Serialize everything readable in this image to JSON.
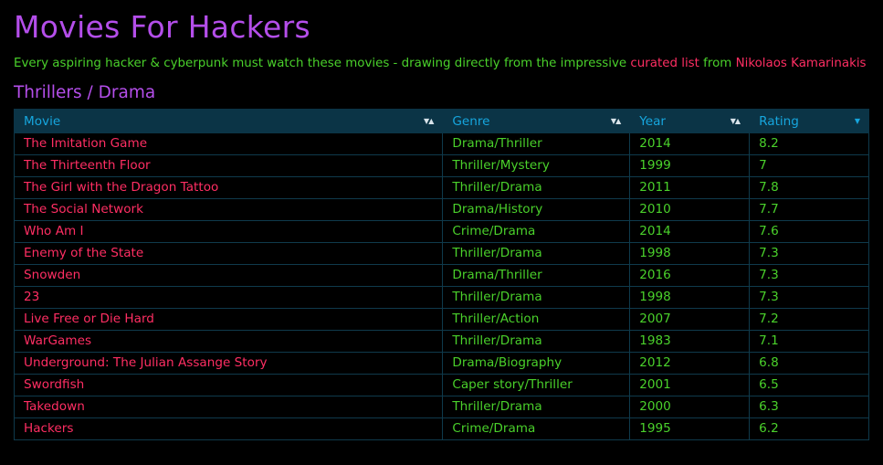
{
  "page": {
    "title": "Movies For Hackers",
    "intro_text": "Every aspiring hacker & cyberpunk must watch these movies - drawing directly from the impressive ",
    "intro_link": "curated list",
    "intro_from": " from ",
    "intro_author": "Nikolaos Kamarinakis"
  },
  "section": {
    "title": "Thrillers / Drama"
  },
  "table": {
    "headers": [
      "Movie",
      "Genre",
      "Year",
      "Rating"
    ],
    "rows": [
      [
        "The Imitation Game",
        "Drama/Thriller",
        "2014",
        "8.2"
      ],
      [
        "The Thirteenth Floor",
        "Thriller/Mystery",
        "1999",
        "7"
      ],
      [
        "The Girl with the Dragon Tattoo",
        "Thriller/Drama",
        "2011",
        "7.8"
      ],
      [
        "The Social Network",
        "Drama/History",
        "2010",
        "7.7"
      ],
      [
        "Who Am I",
        "Crime/Drama",
        "2014",
        "7.6"
      ],
      [
        "Enemy of the State",
        "Thriller/Drama",
        "1998",
        "7.3"
      ],
      [
        "Snowden",
        "Drama/Thriller",
        "2016",
        "7.3"
      ],
      [
        "23",
        "Thriller/Drama",
        "1998",
        "7.3"
      ],
      [
        "Live Free or Die Hard",
        "Thriller/Action",
        "2007",
        "7.2"
      ],
      [
        "WarGames",
        "Thriller/Drama",
        "1983",
        "7.1"
      ],
      [
        "Underground: The Julian Assange Story",
        "Drama/Biography",
        "2012",
        "6.8"
      ],
      [
        "Swordfish",
        "Caper story/Thriller",
        "2001",
        "6.5"
      ],
      [
        "Takedown",
        "Thriller/Drama",
        "2000",
        "6.3"
      ],
      [
        "Hackers",
        "Crime/Drama",
        "1995",
        "6.2"
      ]
    ]
  }
}
